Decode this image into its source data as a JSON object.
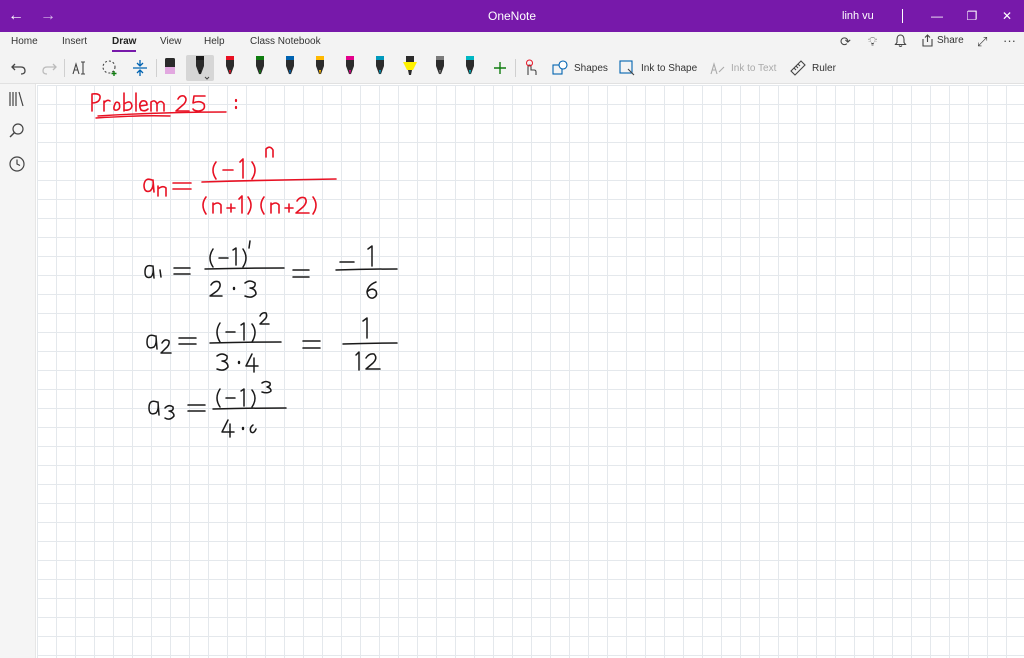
{
  "titlebar": {
    "app_title": "OneNote",
    "user_name": "linh vu",
    "back_icon": "arrow-left-icon",
    "forward_icon": "arrow-right-icon",
    "minimize_icon": "minimize-icon",
    "restore_icon": "restore-icon",
    "close_icon": "close-icon",
    "background_color": "#7719aa"
  },
  "ribbon": {
    "tabs": [
      {
        "label": "Home"
      },
      {
        "label": "Insert"
      },
      {
        "label": "Draw",
        "active": true
      },
      {
        "label": "View"
      },
      {
        "label": "Help"
      },
      {
        "label": "Class Notebook"
      }
    ],
    "actions": {
      "share_label": "Share",
      "sync_icon": "sync-icon",
      "lightbulb_icon": "lightbulb-icon",
      "bell_icon": "bell-icon",
      "expand_icon": "expand-icon",
      "more_icon": "more-icon"
    },
    "draw_tools": {
      "shapes_label": "Shapes",
      "ink_to_shape_label": "Ink to Shape",
      "ink_to_text_label": "Ink to Text",
      "ruler_label": "Ruler",
      "pens": [
        {
          "name": "eraser",
          "color": "#e2a8e0"
        },
        {
          "name": "pen-black-selected",
          "color": "#1a1a1a"
        },
        {
          "name": "pen-red",
          "color": "#e81123"
        },
        {
          "name": "pen-green",
          "color": "#107c10"
        },
        {
          "name": "pen-blue",
          "color": "#0063b1"
        },
        {
          "name": "pen-yellow",
          "color": "#ffb900"
        },
        {
          "name": "pen-magenta",
          "color": "#e3008c"
        },
        {
          "name": "pen-cyan",
          "color": "#0099bc"
        },
        {
          "name": "highlighter-yellow",
          "color": "#fff100"
        },
        {
          "name": "pen-gray",
          "color": "#7a7a7a"
        },
        {
          "name": "pen-teal",
          "color": "#00b7c3"
        }
      ]
    }
  },
  "left_rail": {
    "icons": [
      "notebooks-icon",
      "search-icon",
      "recent-icon"
    ]
  },
  "canvas": {
    "ink_red_color": "#e81123",
    "ink_black_color": "#1a1a1a"
  }
}
